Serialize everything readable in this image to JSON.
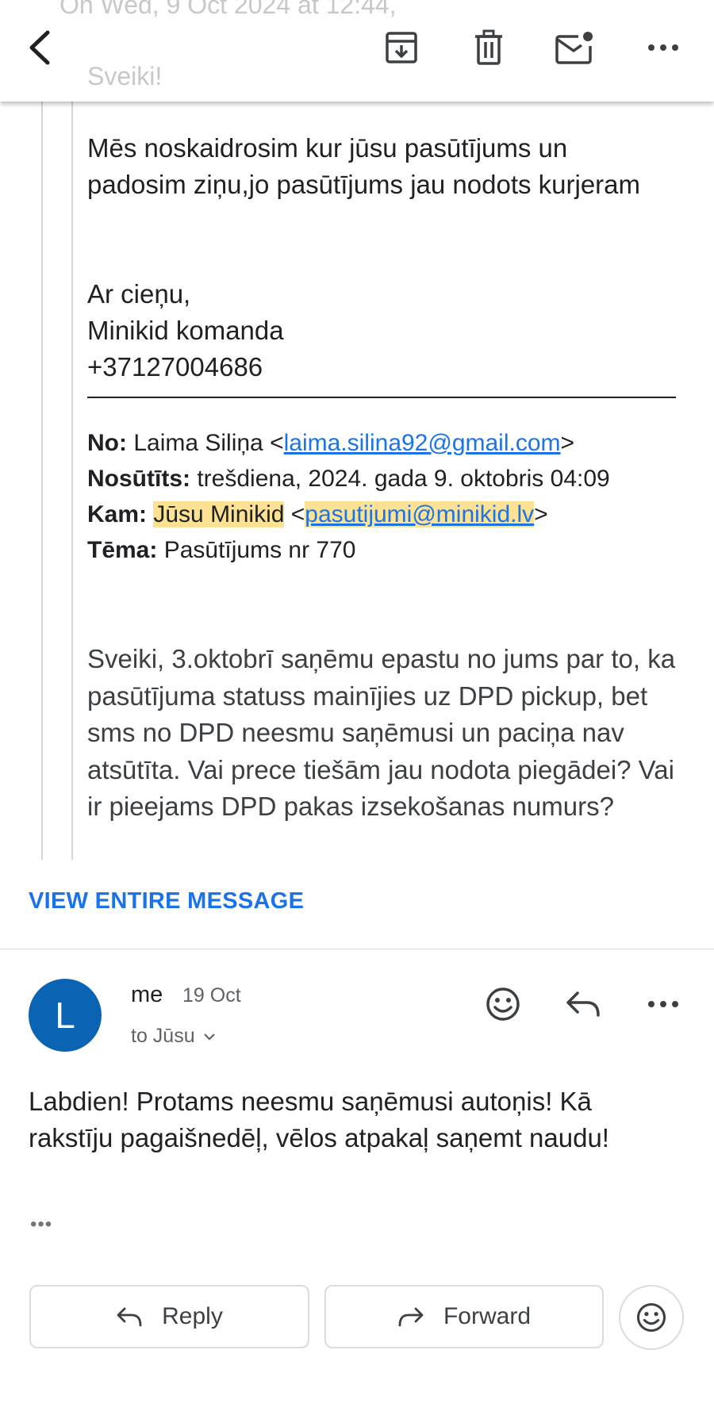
{
  "toolbar": {
    "ghost_line1": "On Wed, 9 Oct 2024 at 12:44, ",
    "ghost_line1_hl": "",
    "ghost_line2": "",
    "ghost_line3": "Sveiki!"
  },
  "quoted": {
    "body1": "Mēs noskaidrosim kur jūsu pasūtījums un padosim ziņu,jo pasūtījums jau nodots kurjeram",
    "sign_line1": "Ar cieņu,",
    "sign_line2": "Minikid komanda",
    "sign_line3": "+37127004686",
    "from_label": "No:",
    "from_name": "Laima Siliņa <",
    "from_email": "laima.silina92@gmail.com",
    "from_close": ">",
    "sent_label": "Nosūtīts:",
    "sent_value": "trešdiena, 2024. gada 9. oktobris 04:09",
    "to_label": "Kam:",
    "to_name": "Jūsu Minikid",
    "to_open": " <",
    "to_email": "pasutijumi@minikid.lv",
    "to_close": ">",
    "subject_label": "Tēma:",
    "subject_value": "Pasūtījums nr 770",
    "body2": "Sveiki, 3.oktobrī saņēmu epastu no jums par to, ka pasūtījuma statuss mainījies uz DPD pickup, bet sms no DPD neesmu saņēmusi un paciņa nav atsūtīta. Vai prece tiešām jau nodota piegādei? Vai ir pieejams DPD pakas izsekošanas numurs?"
  },
  "view_entire": "VIEW ENTIRE MESSAGE",
  "message": {
    "avatar_letter": "L",
    "sender": "me",
    "date": "19 Oct",
    "to": "to Jūsu",
    "body": "Labdien! Protams neesmu saņēmusi autoņis! Kā rakstīju pagaišnedēļ, vēlos atpakaļ saņemt naudu!",
    "more_dots": "•••"
  },
  "actions": {
    "reply_label": "Reply",
    "forward_label": "Forward"
  },
  "colors": {
    "accent": "#1a73e8",
    "avatar": "#0b63b3",
    "highlight": "#fde293"
  },
  "icons": [
    "back-arrow-icon",
    "archive-icon",
    "trash-icon",
    "mark-unread-icon",
    "more-vert-icon",
    "emoji-icon",
    "reply-icon",
    "forward-icon",
    "chevron-down-icon"
  ]
}
